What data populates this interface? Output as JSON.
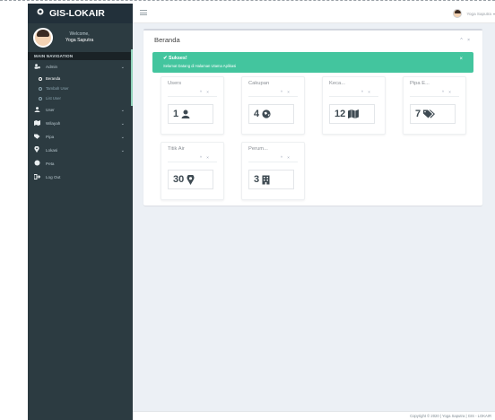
{
  "brand": {
    "name": "GIS-LOKAIR"
  },
  "user_panel": {
    "greeting": "Welcome,",
    "name": "Yoga Saputra"
  },
  "nav_header": "MAIN NAVIGATION",
  "sidebar": {
    "items": [
      {
        "label": "Admin",
        "icon": "person-gear-icon"
      },
      {
        "label": "User",
        "icon": "user-icon"
      },
      {
        "label": "Wilayah",
        "icon": "map-icon"
      },
      {
        "label": "Pipa",
        "icon": "tags-icon"
      },
      {
        "label": "Lokasi",
        "icon": "map-marker-icon"
      },
      {
        "label": "Peta",
        "icon": "globe-icon"
      },
      {
        "label": "Log Out",
        "icon": "sign-out-icon"
      }
    ],
    "admin_sub": [
      "Beranda",
      "Tambah User",
      "List User"
    ]
  },
  "header": {
    "user_name": "Yoga Saputra"
  },
  "box": {
    "title": "Beranda",
    "tools": "^ ×"
  },
  "alert": {
    "title": "✔ Sukses!",
    "message": "Selamat Datang di Halaman Utama Aplikasi",
    "close": "×"
  },
  "cards": [
    {
      "title": "Users",
      "tools": "^ ×",
      "value": "1",
      "icon": "user-icon"
    },
    {
      "title": "Cakupan",
      "tools": "^ ×",
      "value": "4",
      "icon": "globe-icon"
    },
    {
      "title": "Keca...",
      "tools": "^ ×",
      "value": "12",
      "icon": "map-icon"
    },
    {
      "title": "Pipa E...",
      "tools": "^ ×",
      "value": "7",
      "icon": "tags-icon"
    },
    {
      "title": "Titik Air",
      "tools": "^ ×",
      "value": "30",
      "icon": "map-marker-icon"
    },
    {
      "title": "Perum...",
      "tools": "^ ×",
      "value": "3",
      "icon": "building-icon"
    }
  ],
  "footer": {
    "text": "Copyright © 2020 | Yoga Saputra | GIS - LOKAIR"
  },
  "colors": {
    "sidebar": "#2c3b41",
    "alert": "#43c59e",
    "content_bg": "#ecf0f5"
  }
}
